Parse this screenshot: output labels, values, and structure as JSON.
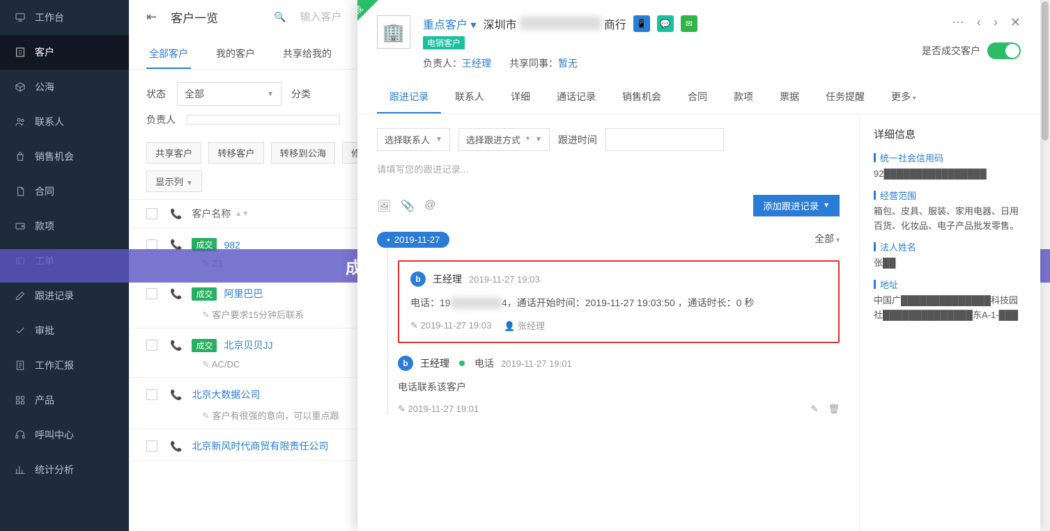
{
  "sidebar": {
    "items": [
      {
        "label": "工作台"
      },
      {
        "label": "客户"
      },
      {
        "label": "公海"
      },
      {
        "label": "联系人"
      },
      {
        "label": "销售机会"
      },
      {
        "label": "合同"
      },
      {
        "label": "款项"
      },
      {
        "label": "工单"
      },
      {
        "label": "跟进记录"
      },
      {
        "label": "审批"
      },
      {
        "label": "工作汇报"
      },
      {
        "label": "产品"
      },
      {
        "label": "呼叫中心"
      },
      {
        "label": "统计分析"
      }
    ]
  },
  "topbar": {
    "page_title": "客户一览",
    "search_placeholder": "输入客户"
  },
  "tabs": [
    "全部客户",
    "我的客户",
    "共享给我的"
  ],
  "filters": {
    "status_label": "状态",
    "status_value": "全部",
    "class_label": "分类",
    "owner_label": "负责人"
  },
  "actions": [
    "共享客户",
    "转移客户",
    "转移到公海",
    "修改",
    "显示列"
  ],
  "list_header": {
    "name_col": "客户名称"
  },
  "rows": [
    {
      "badge": "成交",
      "name": "982",
      "note": "23"
    },
    {
      "badge": "成交",
      "name": "阿里巴巴",
      "note": "客户要求15分钟后联系"
    },
    {
      "badge": "成交",
      "name": "北京贝贝JJ",
      "note": "AC/DC"
    },
    {
      "badge": "",
      "name": "北京大数据公司",
      "note": "客户有很强的意向，可以重点跟"
    },
    {
      "badge": "",
      "name": "北京新风时代商贸有限责任公司",
      "note": ""
    }
  ],
  "banner": "成品视频 CRM：打造高效客户关系管理的利器",
  "panel": {
    "corner": "成交",
    "tag": "重点客户",
    "company_prefix": "深圳市",
    "company_hidden": "██████████",
    "company_suffix": "商行",
    "tele_tag": "电销客户",
    "owner_label": "负责人：",
    "owner_value": "王经理",
    "share_label": "共享同事：",
    "share_value": "暂无",
    "deal_label": "是否成交客户",
    "tabs": [
      "跟进记录",
      "联系人",
      "详细",
      "通话记录",
      "销售机会",
      "合同",
      "款项",
      "票据",
      "任务提醒",
      "更多"
    ],
    "compose": {
      "contact": "选择联系人",
      "method": "选择跟进方式",
      "time_label": "跟进时间",
      "placeholder": "请填写您的跟进记录...",
      "add": "添加跟进记录"
    },
    "timeline_filter": "全部",
    "date_pill": "2019-11-27",
    "entries": [
      {
        "author": "王经理",
        "time": "2019-11-27 19:03",
        "body_prefix": "电话：19",
        "body_hidden": "███████",
        "body_mid": "4，通话开始时间：2019-11-27 19:03:50 ，通话时长：",
        "body_dur": "0 秒",
        "foot_time": "2019-11-27 19:03",
        "foot_user": "张经理"
      },
      {
        "author": "王经理",
        "channel": "电话",
        "time": "2019-11-27 19:01",
        "body": "电话联系该客户",
        "foot_time": "2019-11-27 19:01"
      }
    ],
    "detail": {
      "title": "详细信息",
      "uscc_label": "统一社会信用码",
      "uscc_value": "92████████████████",
      "scope_label": "经营范围",
      "scope_value": "箱包、皮具、服装、家用电器、日用百货、化妆品、电子产品批发零售。",
      "legal_label": "法人姓名",
      "legal_value": "张██",
      "addr_label": "地址",
      "addr_value": "中国广██████████████科技园社██████████████东A-1-███"
    }
  }
}
